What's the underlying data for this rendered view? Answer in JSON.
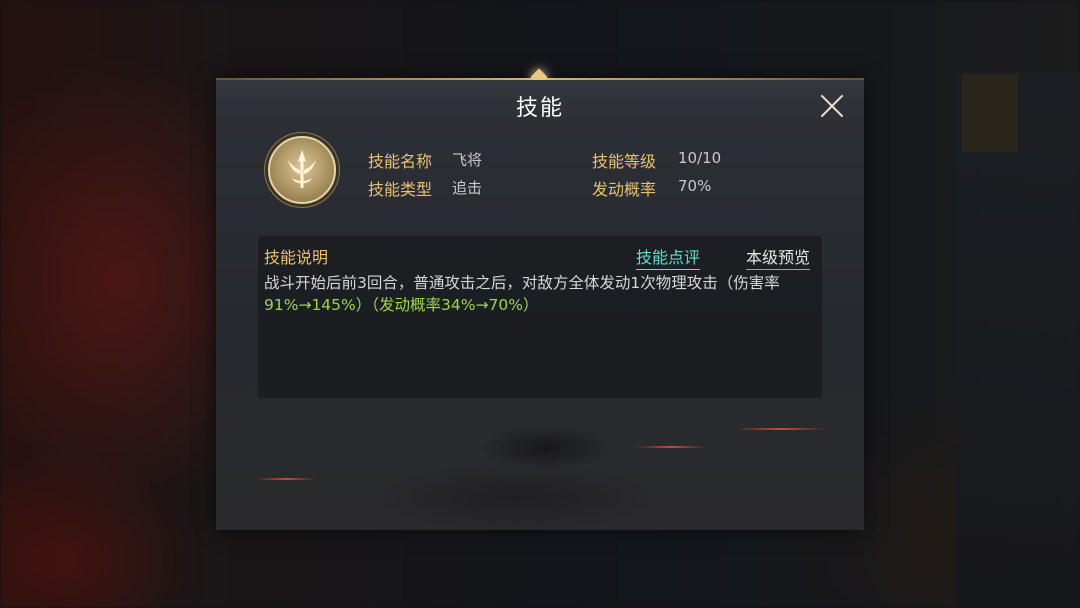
{
  "dialog": {
    "title": "技能",
    "close_icon": "close-icon"
  },
  "skill": {
    "icon": "spear-emblem-icon",
    "name_label": "技能名称",
    "name_value": "飞将",
    "type_label": "技能类型",
    "type_value": "追击",
    "level_label": "技能等级",
    "level_value": "10/10",
    "rate_label": "发动概率",
    "rate_value": "70%"
  },
  "description": {
    "title": "技能说明",
    "tab_review": "技能点评",
    "tab_preview": "本级预览",
    "text_main": "战斗开始后前3回合，普通攻击之后，对敌方全体发动1次物理攻击（伤害率",
    "text_highlight1": "91%→145%",
    "text_sep": "）（",
    "text_highlight2": "发动概率34%→70%",
    "text_end": "）"
  },
  "colors": {
    "gold_label": "#e8c070",
    "value_grey": "#c9c9c9",
    "tab_active": "#59e0d2",
    "highlight_green": "#9ad64a"
  }
}
